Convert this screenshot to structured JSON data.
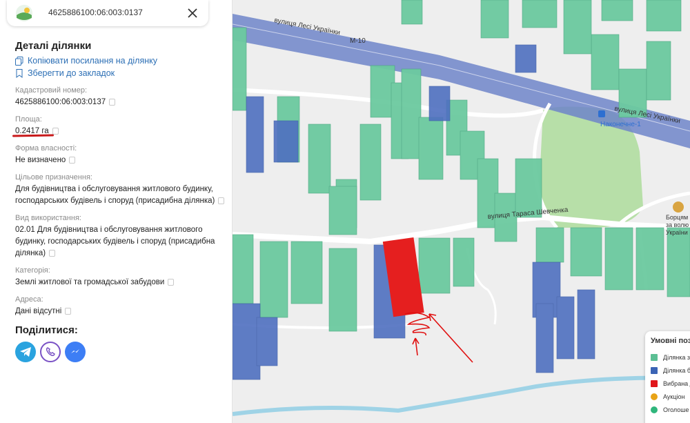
{
  "search": {
    "value": "4625886100:06:003:0137"
  },
  "details": {
    "title": "Деталі ділянки",
    "copy_link": "Копіювати посилання на ділянку",
    "bookmark": "Зберегти до закладок",
    "fields": [
      {
        "label": "Кадастровий номер:",
        "value": "4625886100:06:003:0137"
      },
      {
        "label": "Площа:",
        "value": "0.2417 га"
      },
      {
        "label": "Форма власності:",
        "value": "Не визначено"
      },
      {
        "label": "Цільове призначення:",
        "value": "Для будівництва і обслуговування житлового будинку, господарських будівель і споруд (присадибна ділянка)"
      },
      {
        "label": "Вид використання:",
        "value": "02.01 Для будівництва і обслуговування житлового будинку, господарських будівель і споруд (присадибна ділянка)"
      },
      {
        "label": "Категорія:",
        "value": "Землі житлової та громадської забудови"
      },
      {
        "label": "Адреса:",
        "value": "Дані відсутні"
      }
    ],
    "share_title": "Поділитися:",
    "share": [
      "telegram",
      "viber",
      "messenger"
    ]
  },
  "map": {
    "labels": {
      "street_lesi_1": "вулиця Лесі Українки",
      "street_lesi_2": "вулиця Лесі Українки",
      "road": "М-10",
      "bus_stop": "Наконечне-1",
      "street_shevchenka": "вулиця Тараса Шевченка",
      "memorial_1": "Борцям",
      "memorial_2": "за волю",
      "memorial_3": "України"
    }
  },
  "legend": {
    "title": "Умовні поз",
    "items": [
      {
        "label": "Ділянка з",
        "color": "#5cbf94"
      },
      {
        "label": "Ділянка б",
        "color": "#3b64b5"
      },
      {
        "label": "Вибрана д",
        "color": "#e0161b"
      },
      {
        "label": "Аукціон",
        "color": "#e8a317"
      },
      {
        "label": "Оголоше",
        "color": "#2fb67c"
      }
    ]
  },
  "colors": {
    "green_parcel": "#6ccaa0",
    "blue_parcel": "#4f70c0",
    "selected": "#e51f1f",
    "link": "#2c6fb5"
  }
}
